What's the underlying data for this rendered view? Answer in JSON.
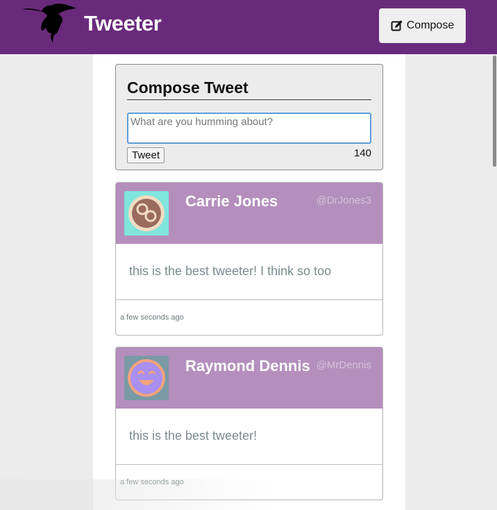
{
  "nav": {
    "brand": "Tweeter",
    "compose_label": "Compose",
    "logo_icon": "hummingbird-icon",
    "compose_icon": "edit-icon",
    "bar_color": "#6a2a7b"
  },
  "composer": {
    "title": "Compose Tweet",
    "placeholder": "What are you humming about?",
    "value": "",
    "submit_label": "Tweet",
    "char_count": "140"
  },
  "tweets": [
    {
      "name": "Carrie Jones",
      "handle": "@DrJones3",
      "text": "this is the best tweeter! I think so too",
      "time": "a few seconds ago",
      "avatar_icon": "glasses-face-avatar",
      "header_color": "#b48fbd"
    },
    {
      "name": "Raymond Dennis",
      "handle": "@MrDennis",
      "text": "this is the best tweeter!",
      "time": "a few seconds ago",
      "avatar_icon": "smiley-face-avatar",
      "header_color": "#b48fbd"
    }
  ]
}
